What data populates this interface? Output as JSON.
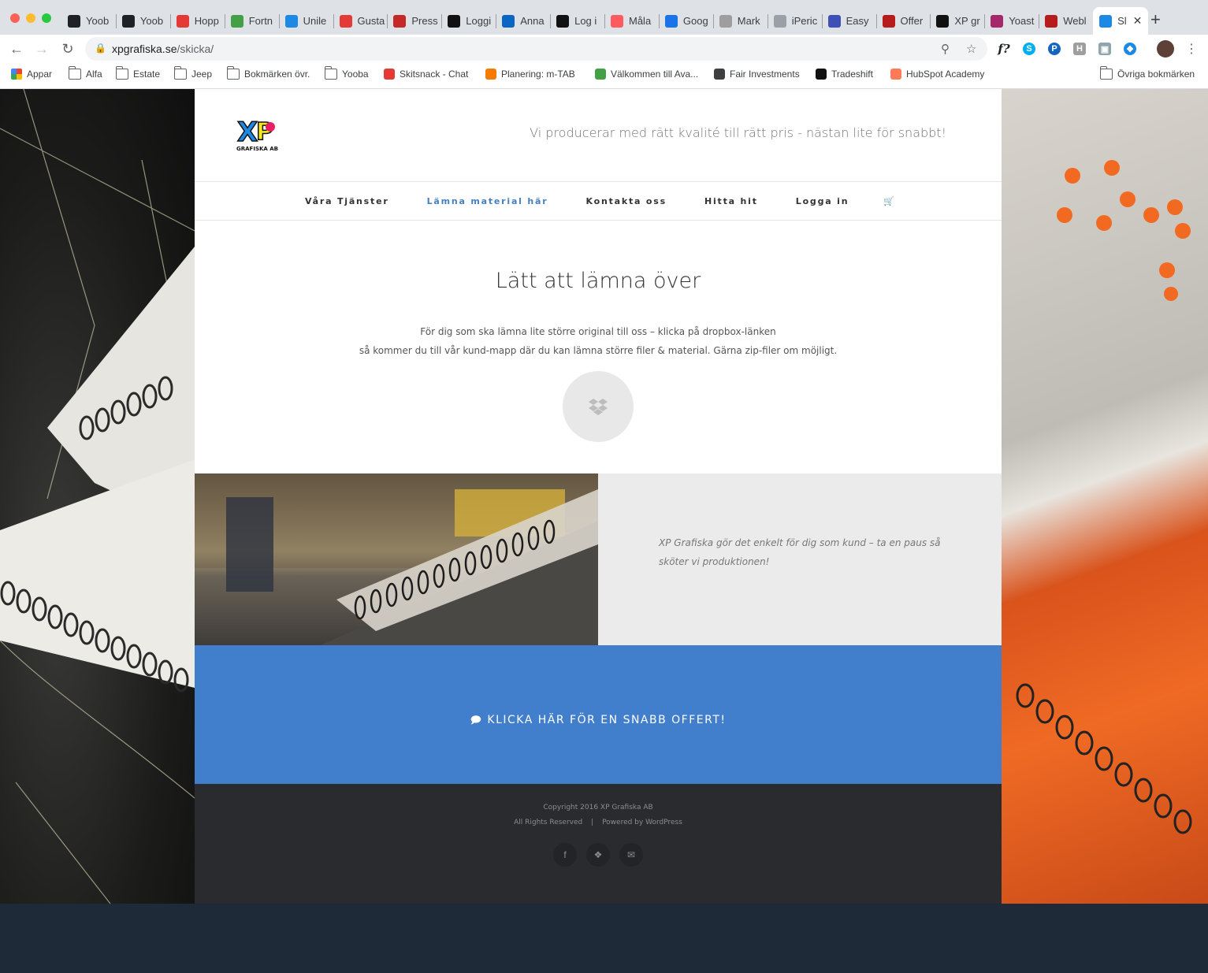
{
  "browser": {
    "tabs": [
      {
        "label": "Yoob",
        "icon": "yooba-icon",
        "color": "#202124"
      },
      {
        "label": "Yoob",
        "icon": "yooba-icon",
        "color": "#202124"
      },
      {
        "label": "Hopp",
        "icon": "hopp-icon",
        "color": "#e53935"
      },
      {
        "label": "Fortn",
        "icon": "fortnox-icon",
        "color": "#43a047"
      },
      {
        "label": "Unile",
        "icon": "unilever-icon",
        "color": "#1e88e5"
      },
      {
        "label": "Gusta",
        "icon": "gusta-icon",
        "color": "#e53935"
      },
      {
        "label": "Press",
        "icon": "press-icon",
        "color": "#c62828"
      },
      {
        "label": "Loggi",
        "icon": "tradeshift-icon",
        "color": "#111111"
      },
      {
        "label": "Anna",
        "icon": "linkedin-icon",
        "color": "#0a66c2"
      },
      {
        "label": "Log i",
        "icon": "p-icon",
        "color": "#111111"
      },
      {
        "label": "Måla",
        "icon": "airbnb-icon",
        "color": "#ff5a5f"
      },
      {
        "label": "Goog",
        "icon": "calendar-icon",
        "color": "#1a73e8"
      },
      {
        "label": "Mark",
        "icon": "mark-icon",
        "color": "#9e9e9e"
      },
      {
        "label": "iPeric",
        "icon": "clock-icon",
        "color": "#9aa0a6"
      },
      {
        "label": "Easy",
        "icon": "easy-icon",
        "color": "#3f51b5"
      },
      {
        "label": "Offer",
        "icon": "st-icon",
        "color": "#b71c1c"
      },
      {
        "label": "XP gr",
        "icon": "xp-icon",
        "color": "#111111"
      },
      {
        "label": "Yoast",
        "icon": "yoast-icon",
        "color": "#a4286a"
      },
      {
        "label": "Webl",
        "icon": "l-icon",
        "color": "#b71c1c"
      },
      {
        "label": "Sl",
        "icon": "xp-logo-icon",
        "color": "#1e88e5"
      }
    ],
    "url_domain": "xpgrafiska.se",
    "url_path": "/skicka/",
    "bookmarks": [
      {
        "label": "Appar",
        "icon": "apps-grid-icon"
      },
      {
        "label": "Alfa",
        "icon": "folder-icon"
      },
      {
        "label": "Estate",
        "icon": "folder-icon"
      },
      {
        "label": "Jeep",
        "icon": "folder-icon"
      },
      {
        "label": "Bokmärken övr.",
        "icon": "folder-icon"
      },
      {
        "label": "Yooba",
        "icon": "folder-icon"
      },
      {
        "label": "Skitsnack - Chat",
        "icon": "chat-icon"
      },
      {
        "label": "Planering:  m-TAB",
        "icon": "f-icon"
      },
      {
        "label": "Välkommen till Ava...",
        "icon": "bars-icon"
      },
      {
        "label": "Fair Investments",
        "icon": "globe-icon"
      },
      {
        "label": "Tradeshift",
        "icon": "tradeshift-icon"
      },
      {
        "label": "HubSpot Academy",
        "icon": "hubspot-icon"
      },
      {
        "label": "Övriga bokmärken",
        "icon": "folder-icon"
      }
    ]
  },
  "site": {
    "tagline": "Vi producerar med rätt kvalité till rätt pris - nästan lite för snabbt!",
    "logo_text": "GRAFISKA AB",
    "menu": [
      {
        "label": "Våra Tjänster",
        "active": false
      },
      {
        "label": "Lämna material här",
        "active": true
      },
      {
        "label": "Kontakta oss",
        "active": false
      },
      {
        "label": "Hitta hit",
        "active": false
      },
      {
        "label": "Logga in",
        "active": false
      }
    ],
    "title": "Lätt att lämna över",
    "text_line1": "För dig som ska lämna lite större original till oss – klicka på dropbox-länken",
    "text_line2": "så kommer du till vår kund-mapp där du kan lämna större filer & material. Gärna zip-filer om möjligt.",
    "quote": "XP Grafiska gör det enkelt för dig som kund – ta en paus så sköter vi produktionen!",
    "cta": "KLICKA HÄR FÖR EN SNABB OFFERT!",
    "footer_copyright": "Copyright 2016 XP Grafiska AB",
    "footer_rights": "All Rights Reserved",
    "footer_sep": "|",
    "footer_powered": "Powered by WordPress",
    "social": [
      "facebook-icon",
      "dropbox-icon",
      "mail-icon"
    ]
  },
  "colors": {
    "accent": "#4580c4",
    "cta_bg": "#417ecc",
    "footer_bg": "#2a2b2f"
  }
}
